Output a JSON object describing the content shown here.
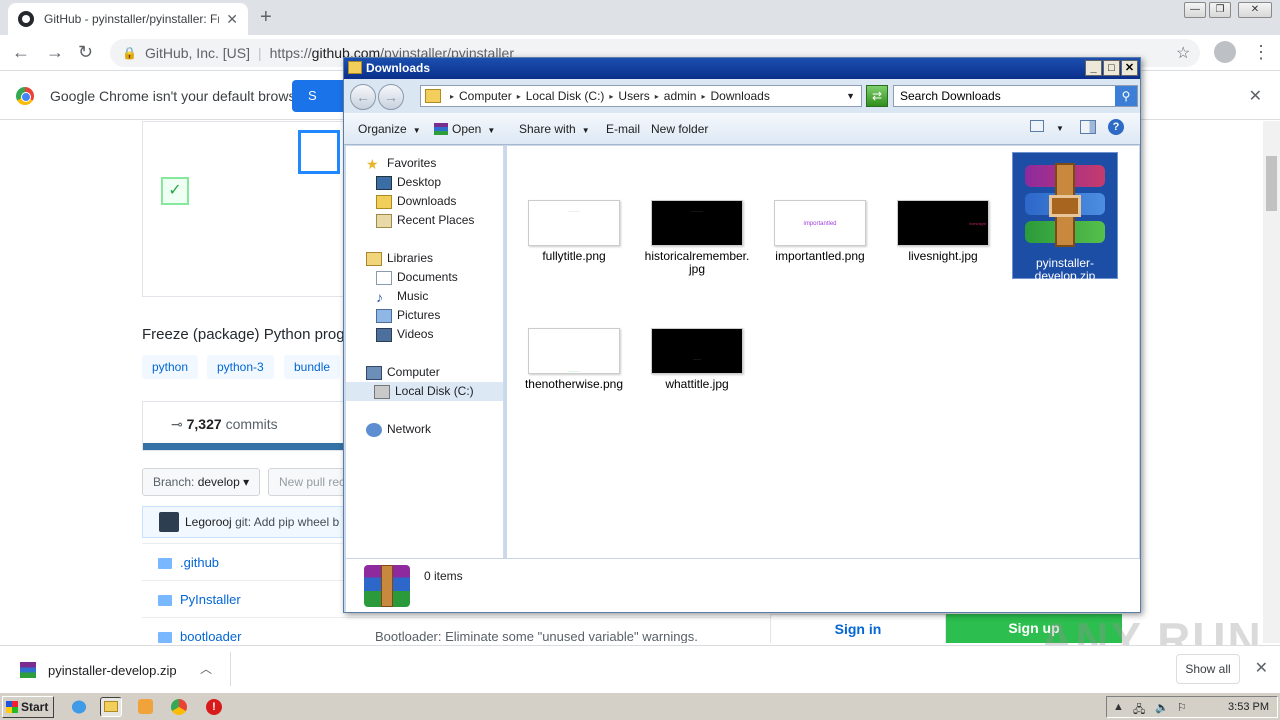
{
  "browser": {
    "tab_title": "GitHub - pyinstaller/pyinstaller: Freeze (package) Python programs into stand-alone executables",
    "omnibox_org": "GitHub, Inc. [US]",
    "omnibox_url_prefix": "https://",
    "omnibox_url_host": "github.com",
    "omnibox_url_path": "/pyinstaller/pyinstaller",
    "infobar_message": "Google Chrome isn't your default browser",
    "infobar_button": "S"
  },
  "github": {
    "description": "Freeze (package) Python prog",
    "topics": [
      "python",
      "python-3",
      "bundle"
    ],
    "commits_count": "7,327",
    "commits_label": "commits",
    "branch_label": "Branch:",
    "branch_name": "develop",
    "new_pull_request": "New pull rec",
    "latest_commit_author": "Legorooj",
    "latest_commit_message": "git: Add pip wheel b",
    "files": [
      ".github",
      "PyInstaller",
      "bootloader"
    ],
    "bootloader_commit": "Bootloader: Eliminate some \"unused variable\" warnings.",
    "sign_in": "Sign in",
    "sign_up": "Sign up"
  },
  "explorer": {
    "title": "Downloads",
    "breadcrumb": [
      "Computer",
      "Local Disk (C:)",
      "Users",
      "admin",
      "Downloads"
    ],
    "search_placeholder": "Search Downloads",
    "commands": {
      "organize": "Organize",
      "open": "Open",
      "share_with": "Share with",
      "email": "E-mail",
      "new_folder": "New folder"
    },
    "nav": {
      "favorites": "Favorites",
      "desktop": "Desktop",
      "downloads": "Downloads",
      "recent_places": "Recent Places",
      "libraries": "Libraries",
      "documents": "Documents",
      "music": "Music",
      "pictures": "Pictures",
      "videos": "Videos",
      "computer": "Computer",
      "local_disk": "Local Disk (C:)",
      "network": "Network"
    },
    "files": [
      {
        "name": "fullytitle.png",
        "thumb_text": "———"
      },
      {
        "name": "historicalremember.jpg",
        "thumb_text": "———"
      },
      {
        "name": "importantled.png",
        "thumb_text": "importantled"
      },
      {
        "name": "livesnight.jpg",
        "thumb_text": "livesnight"
      },
      {
        "name": "pyinstaller-develop.zip",
        "thumb_text": ""
      },
      {
        "name": "thenotherwise.png",
        "thumb_text": "———"
      },
      {
        "name": "whattitle.jpg",
        "thumb_text": "——"
      }
    ],
    "status": "0 items"
  },
  "shelf": {
    "download_name": "pyinstaller-develop.zip",
    "show_all": "Show all"
  },
  "taskbar": {
    "start": "Start",
    "clock": "3:53 PM"
  },
  "watermark": "ANY RUN"
}
